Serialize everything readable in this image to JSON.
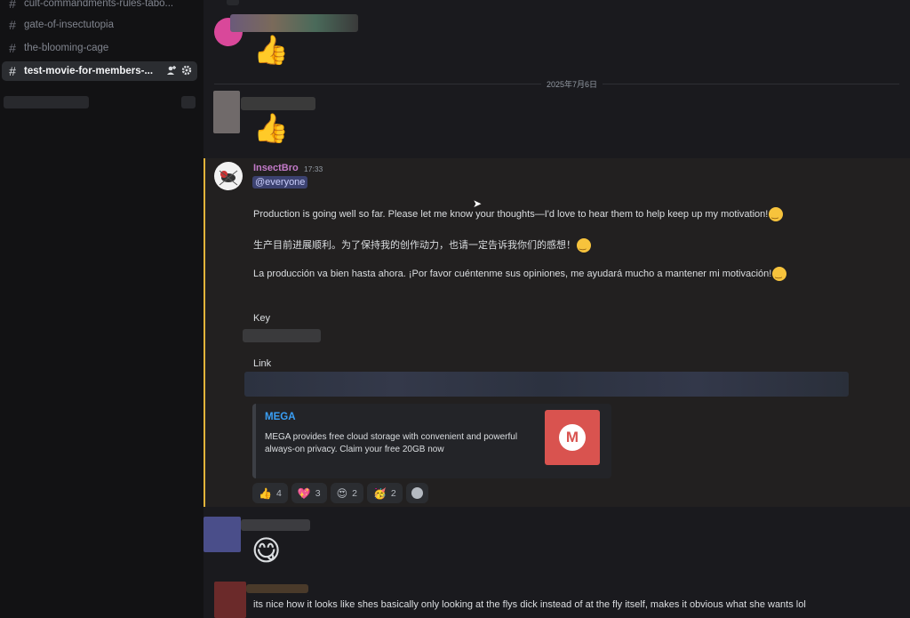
{
  "sidebar": {
    "channels": [
      {
        "label": "cult-commandments-rules-tabo..."
      },
      {
        "label": "gate-of-insectutopia"
      },
      {
        "label": "the-blooming-cage"
      },
      {
        "label": "test-movie-for-members-..."
      }
    ]
  },
  "chat": {
    "date_divider": "2025年7月6日",
    "message": {
      "author": "InsectBro",
      "time": "17:33",
      "mention": "@everyone",
      "line_en": "Production is going well so far. Please let me know your thoughts—I'd love to hear them to help keep up my motivation!",
      "line_zh": "生产目前进展顺利。为了保持我的创作动力，也请一定告诉我你们的感想！",
      "line_es": "La producción va bien hasta ahora. ¡Por favor cuéntenme sus opiniones, me ayudará mucho a mantener mi motivación!",
      "key_label": "Key",
      "link_label": "Link",
      "embed": {
        "title": "MEGA",
        "description": "MEGA provides free cloud storage with convenient and powerful always-on privacy. Claim your free 20GB now",
        "thumb_letter": "M"
      },
      "reactions": [
        {
          "icon": "👍",
          "count": "4"
        },
        {
          "icon": "💖",
          "count": "3"
        },
        {
          "icon": "😍",
          "count": "2"
        },
        {
          "icon": "🥳",
          "count": "2"
        }
      ]
    },
    "last_message": "its nice how it looks like shes basically only looking at the flys dick instead of at the fly itself, makes it obvious what she wants lol"
  },
  "colors": {
    "highlight_bar": "#e1b33a",
    "author": "#c27ac8",
    "link": "#3a9ff5",
    "mega_red": "#d9534f"
  },
  "icons": [
    "hash-icon",
    "add-member-icon",
    "gear-icon",
    "add-reaction-icon",
    "thumbs-up-icon",
    "smile-emoji-icon",
    "mega-logo-icon"
  ]
}
